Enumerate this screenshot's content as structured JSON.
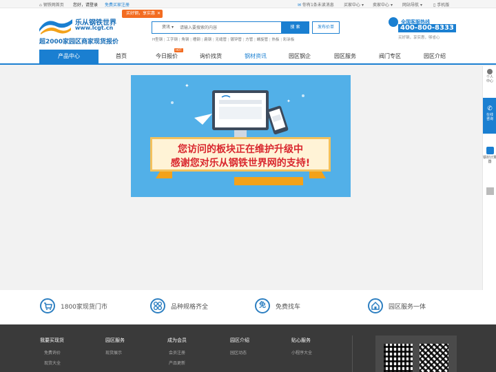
{
  "topbar": {
    "home": "钢铁网首页",
    "greeting": "您好，请登录",
    "register": "免费买家注册",
    "messages": "你有1条未读消息",
    "buyer_center": "买家中心",
    "seller_center": "卖家中心",
    "site_nav": "网站导航",
    "mobile": "手机版"
  },
  "promo_tag": "买好钢，享实惠",
  "logo": {
    "name": "乐从钢铁世界",
    "url": "www.lcgt.cn",
    "slogan": "超2000家园区商家现货报价"
  },
  "search": {
    "category": "资讯",
    "placeholder": "请输入要搜索的内容",
    "button": "搜 索",
    "publish": "发布价单",
    "hot": [
      "H型钢",
      "工字钢",
      "角钢",
      "槽钢",
      "扁钢",
      "无缝管",
      "镀锌管",
      "方管",
      "螺旋管",
      "热板",
      "彩涂板"
    ]
  },
  "hotline": {
    "title": "全国客服热线",
    "number": "400-800-8333",
    "tagline": "买好钢，享实惠，够省心"
  },
  "nav": {
    "items": [
      "产品中心",
      "首页",
      "今日报价",
      "询价找货",
      "钢材资讯",
      "园区钢企",
      "园区服务",
      "阀门专区",
      "园区介绍"
    ],
    "hot_badge": "HOT"
  },
  "banner": {
    "line1": "您访问的板块正在维护升级中",
    "line2": "感谢您对乐从钢铁世界网的支持!"
  },
  "features": [
    {
      "icon": "cart-icon",
      "text": "1800家现货门市"
    },
    {
      "icon": "grid-icon",
      "text": "品种规格齐全"
    },
    {
      "icon": "free-icon",
      "text": "免费找车"
    },
    {
      "icon": "park-icon",
      "text": "园区服务一体"
    }
  ],
  "footer": {
    "cols": [
      {
        "title": "我要买现货",
        "links": [
          "免费询价",
          "现货大全"
        ]
      },
      {
        "title": "园区服务",
        "links": [
          "现货展示"
        ]
      },
      {
        "title": "成为会员",
        "links": [
          "会员注册",
          "产品更新"
        ]
      },
      {
        "title": "园区介绍",
        "links": [
          "园区动态"
        ]
      },
      {
        "title": "贴心服务",
        "links": [
          "小程序大全"
        ]
      }
    ]
  },
  "sidebar": {
    "personal": "个人中心",
    "consult": "在线咨询",
    "calculator": "钢材计算器"
  },
  "colors": {
    "brand_blue": "#1a7fd1",
    "accent_orange": "#f36c21"
  }
}
